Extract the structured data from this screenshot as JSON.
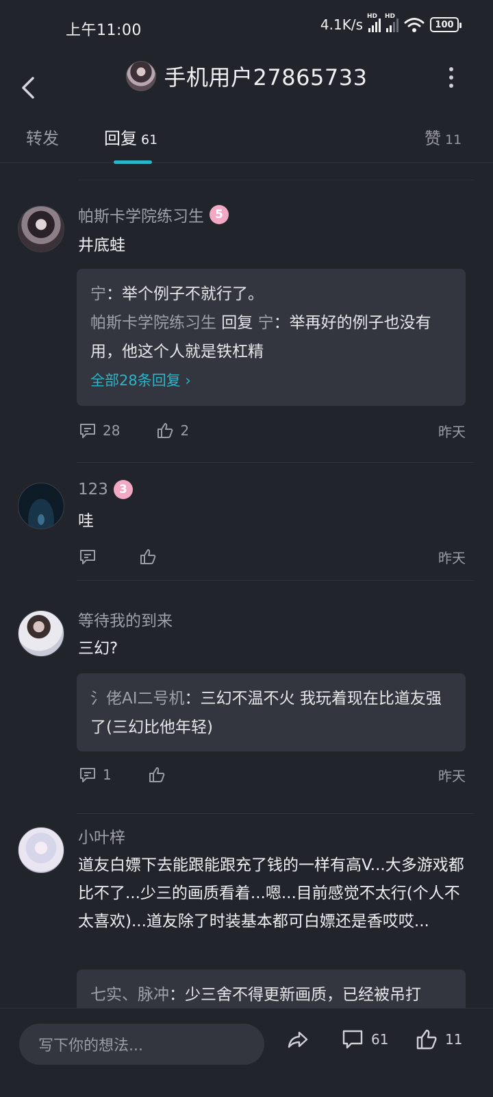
{
  "status": {
    "time": "上午11:00",
    "speed": "4.1K/s",
    "hd1": "HD",
    "hd2": "HD",
    "battery": "100"
  },
  "header": {
    "title": "手机用户27865733"
  },
  "tabs": [
    {
      "label": "转发",
      "count": ""
    },
    {
      "label": "回复",
      "count": "61"
    },
    {
      "label": "赞",
      "count": "11"
    }
  ],
  "comments": [
    {
      "user": "帕斯卡学院练习生",
      "level": "5",
      "text": "井底蛙",
      "replies": {
        "r1_name": "宁",
        "r1_text": "：举个例子不就行了。",
        "r2_name": "帕斯卡学院练习生",
        "r2_mid": " 回复 ",
        "r2_name2": "宁",
        "r2_text": "：举再好的例子也没有用，他这个人就是铁杠精",
        "more": "全部28条回复 ›"
      },
      "reply_count": "28",
      "like_count": "2",
      "time": "昨天"
    },
    {
      "user": "123",
      "level": "3",
      "text": "哇",
      "reply_count": "",
      "like_count": "",
      "time": "昨天"
    },
    {
      "user": "等待我的到来",
      "text": "三幻?",
      "replies": {
        "r1_name": "氵佬AI二号机",
        "r1_text": "：三幻不温不火 我玩着现在比道友强了(三幻比他年轻)"
      },
      "reply_count": "1",
      "like_count": "",
      "time": "昨天"
    },
    {
      "user": "小叶梓",
      "text": "道友白嫖下去能跟能跟充了钱的一样有高V...大多游戏都比不了...少三的画质看着...嗯...目前感觉不太行(个人不太喜欢)...道友除了时装基本都可白嫖还是香哎哎...",
      "replies": {
        "r1_name": "七实、脉冲",
        "r1_text": "：少三舍不得更新画质，已经被吊打"
      }
    }
  ],
  "bottom": {
    "placeholder": "写下你的想法...",
    "comments": "61",
    "likes": "11"
  }
}
